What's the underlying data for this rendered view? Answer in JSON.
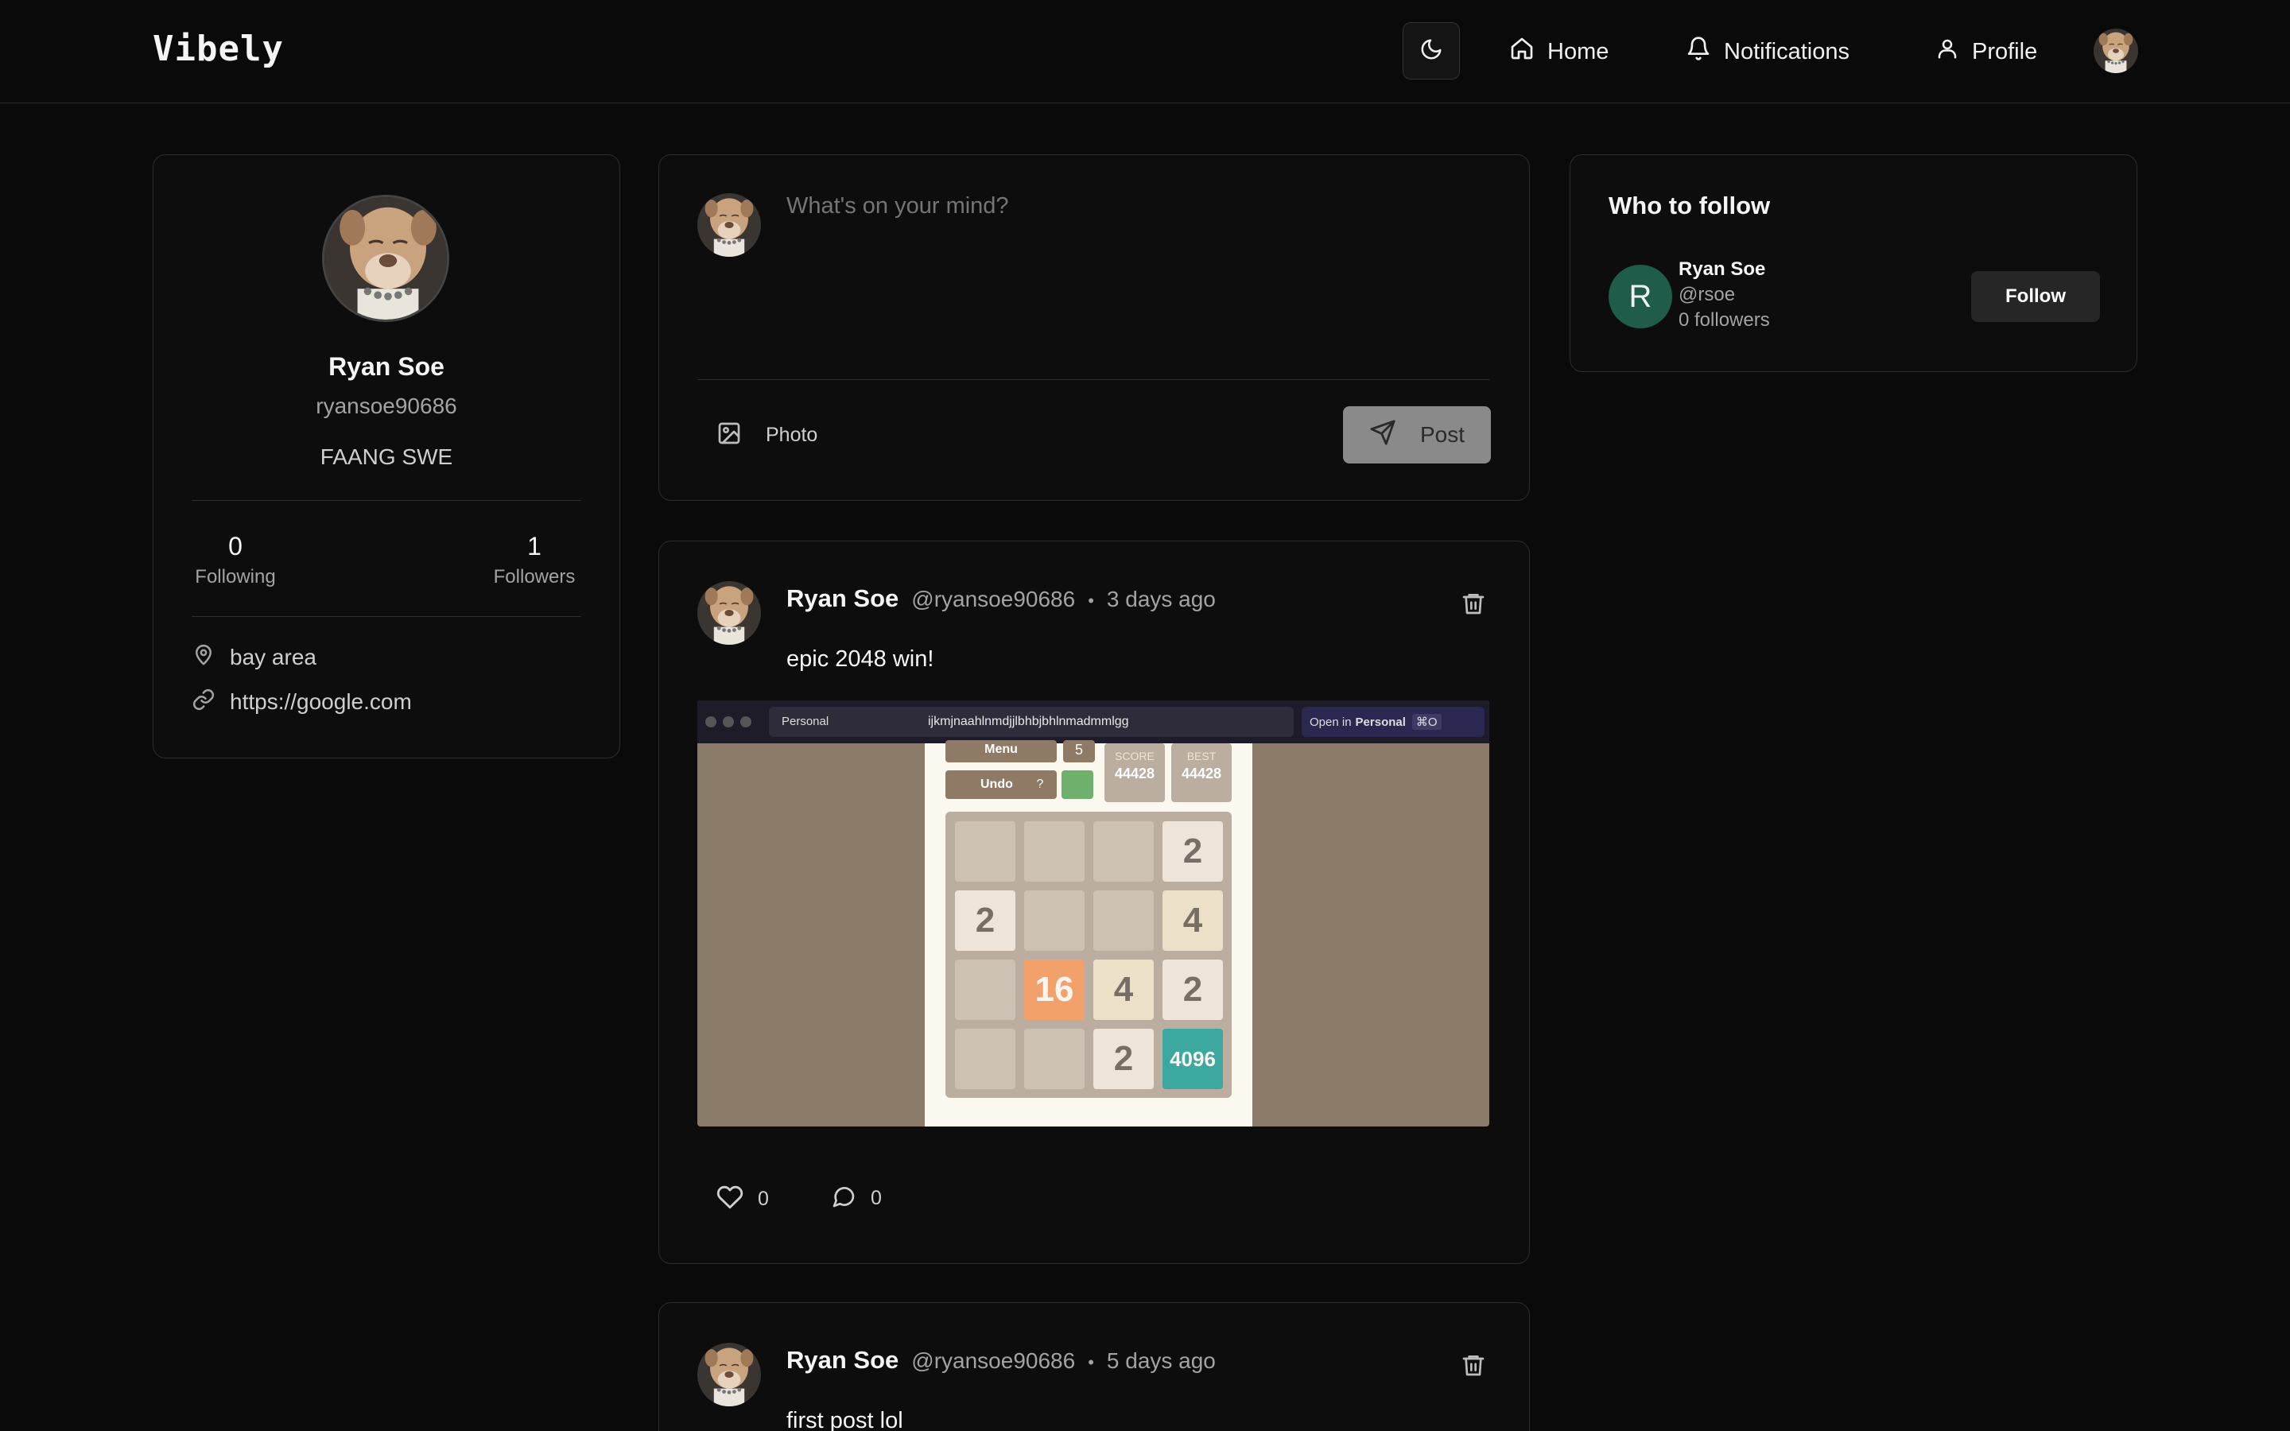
{
  "app": {
    "logo": "Vibely"
  },
  "nav": {
    "home": "Home",
    "notifications": "Notifications",
    "profile": "Profile"
  },
  "profile": {
    "name": "Ryan Soe",
    "username": "ryansoe90686",
    "bio": "FAANG SWE",
    "following_count": "0",
    "following_label": "Following",
    "followers_count": "1",
    "followers_label": "Followers",
    "location": "bay area",
    "website": "https://google.com"
  },
  "composer": {
    "placeholder": "What's on your mind?",
    "photo_label": "Photo",
    "post_label": "Post"
  },
  "posts": [
    {
      "author": "Ryan Soe",
      "handle": "@ryansoe90686",
      "separator": "•",
      "time": "3 days ago",
      "text": "epic 2048 win!",
      "likes": "0",
      "comments": "0",
      "screenshot": {
        "profile_chip": "Personal",
        "address": "ijkmjnaahlnmdjjlbhbjbhlnmadmmlgg",
        "open_in_prefix": "Open in",
        "open_in_target": "Personal",
        "shortcut": "⌘O",
        "menu_label": "Menu",
        "undo_label": "Undo",
        "help_label": "?",
        "moves": "5",
        "score_label": "SCORE",
        "score_value": "44428",
        "best_label": "BEST",
        "best_value": "44428",
        "board": [
          [
            "",
            "",
            "",
            "2"
          ],
          [
            "2",
            "",
            "",
            "4"
          ],
          [
            "",
            "16",
            "4",
            "2"
          ],
          [
            "",
            "",
            "2",
            "4096"
          ]
        ]
      }
    },
    {
      "author": "Ryan Soe",
      "handle": "@ryansoe90686",
      "separator": "•",
      "time": "5 days ago",
      "text": "first post lol"
    }
  ],
  "who_to_follow": {
    "title": "Who to follow",
    "users": [
      {
        "initial": "R",
        "name": "Ryan Soe",
        "handle": "@rsoe",
        "followers": "0 followers",
        "button": "Follow"
      }
    ]
  },
  "colors": {
    "background": "#0a0a0a",
    "card_border": "#2c2c2c",
    "tile_16": "#f2a16b",
    "tile_4096": "#3ca8a0",
    "suggest_avatar": "#1f5c4a"
  },
  "icons": [
    "moon-icon",
    "home-icon",
    "bell-icon",
    "user-icon",
    "map-pin-icon",
    "link-icon",
    "image-icon",
    "send-icon",
    "trash-icon",
    "heart-icon",
    "comment-icon"
  ]
}
